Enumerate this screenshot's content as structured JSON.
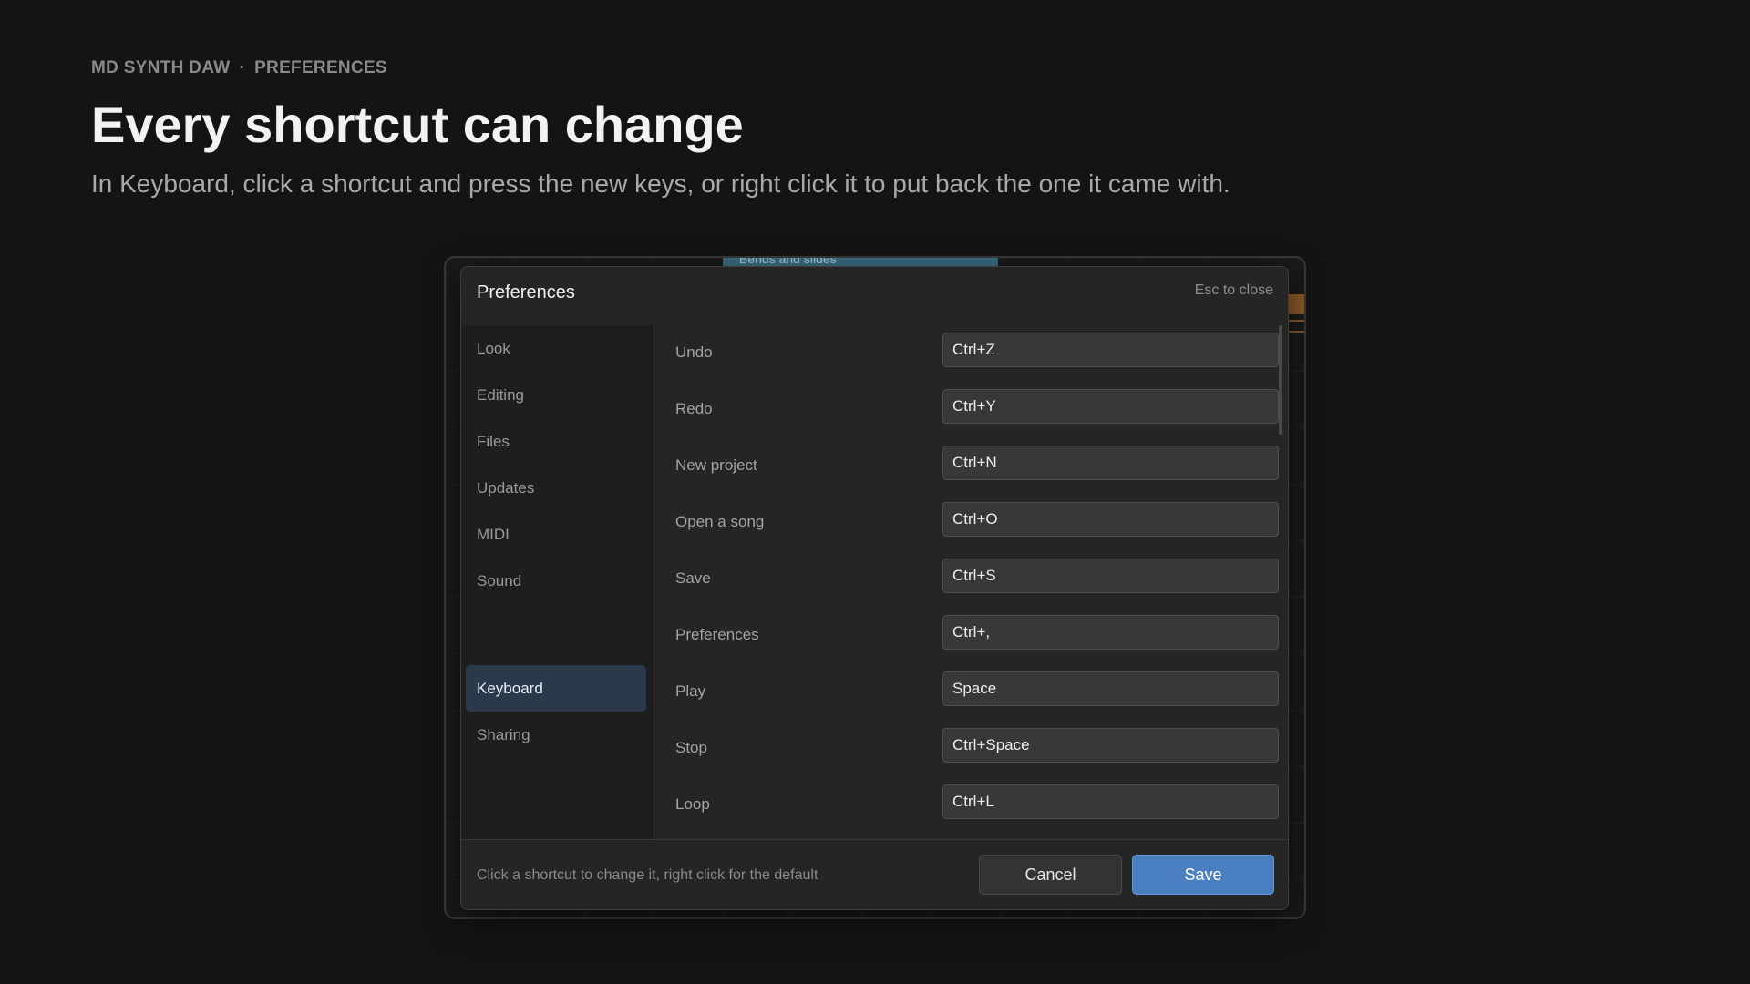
{
  "header": {
    "app": "MD SYNTH DAW",
    "separator": "·",
    "section": "PREFERENCES",
    "title": "Every shortcut can change",
    "subtitle": "In Keyboard, click a shortcut and press the new keys, or right click it to put back the one it came with."
  },
  "background": {
    "clip_label": "Bends and slides"
  },
  "dialog": {
    "title": "Preferences",
    "close_hint": "Esc to close",
    "sidebar": [
      {
        "label": "Look",
        "active": false
      },
      {
        "label": "Editing",
        "active": false
      },
      {
        "label": "Files",
        "active": false
      },
      {
        "label": "Updates",
        "active": false
      },
      {
        "label": "MIDI",
        "active": false
      },
      {
        "label": "Sound",
        "active": false
      },
      {
        "label": "Keyboard",
        "active": true
      },
      {
        "label": "Sharing",
        "active": false
      }
    ],
    "shortcuts": [
      {
        "action": "Undo",
        "keys": "Ctrl+Z"
      },
      {
        "action": "Redo",
        "keys": "Ctrl+Y"
      },
      {
        "action": "New project",
        "keys": "Ctrl+N"
      },
      {
        "action": "Open a song",
        "keys": "Ctrl+O"
      },
      {
        "action": "Save",
        "keys": "Ctrl+S"
      },
      {
        "action": "Preferences",
        "keys": "Ctrl+,"
      },
      {
        "action": "Play",
        "keys": "Space"
      },
      {
        "action": "Stop",
        "keys": "Ctrl+Space"
      },
      {
        "action": "Loop",
        "keys": "Ctrl+L"
      }
    ],
    "footer": {
      "hint": "Click a shortcut to change it, right click for the default",
      "cancel_label": "Cancel",
      "save_label": "Save"
    }
  },
  "colors": {
    "background": "#141414",
    "accent": "#4a80c2",
    "active_nav": "#2a3a4b"
  }
}
